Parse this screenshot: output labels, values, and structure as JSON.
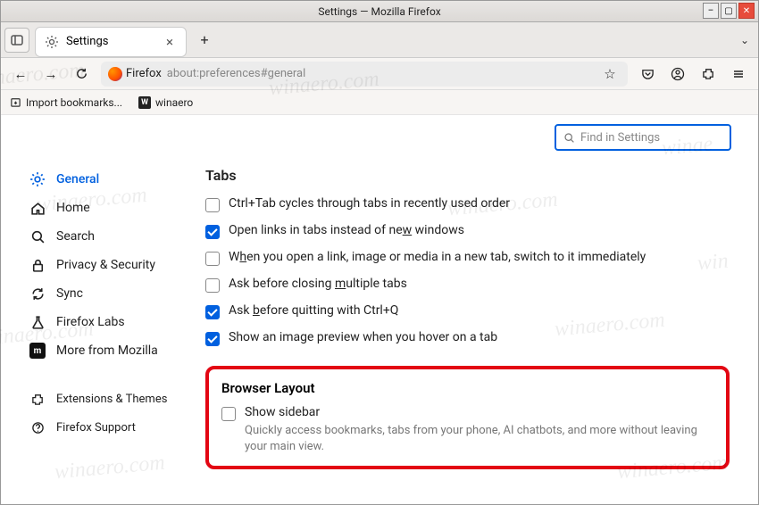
{
  "window": {
    "title": "Settings — Mozilla Firefox"
  },
  "tab": {
    "label": "Settings"
  },
  "url": {
    "host": "Firefox",
    "path": "about:preferences#general"
  },
  "bookmarks": {
    "import": "Import bookmarks...",
    "winaero": "winaero"
  },
  "search": {
    "placeholder": "Find in Settings"
  },
  "nav": {
    "general": "General",
    "home": "Home",
    "search": "Search",
    "privacy": "Privacy & Security",
    "sync": "Sync",
    "labs": "Firefox Labs",
    "more": "More from Mozilla",
    "extensions": "Extensions & Themes",
    "support": "Firefox Support"
  },
  "sections": {
    "tabs_title": "Tabs",
    "ctrl_tab": "Ctrl+Tab cycles through tabs in recently used order",
    "open_links": "Open links in tabs instead of new windows",
    "open_links_u": "w",
    "switch_immediately": "When you open a link, image or media in a new tab, switch to it immediately",
    "switch_u": "h",
    "ask_close_pre": "Ask before closing ",
    "ask_close_u": "m",
    "ask_close_post": "ultiple tabs",
    "ask_quit_pre": "Ask ",
    "ask_quit_u": "b",
    "ask_quit_post": "efore quitting with Ctrl+Q",
    "image_preview": "Show an image preview when you hover on a tab",
    "layout_title": "Browser Layout",
    "show_sidebar": "Show sidebar",
    "show_sidebar_desc": "Quickly access bookmarks, tabs from your phone, AI chatbots, and more without leaving your main view."
  }
}
